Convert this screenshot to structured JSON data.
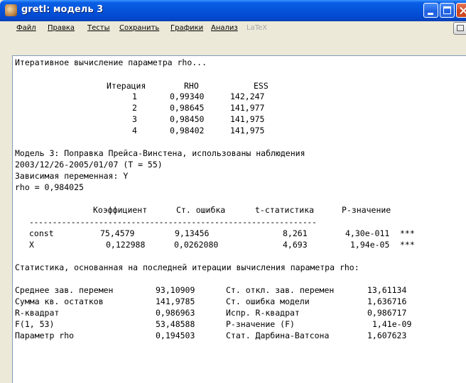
{
  "window": {
    "title": "gretl: модель 3"
  },
  "menu": {
    "file": "Файл",
    "edit": "Правка",
    "tests": "Тесты",
    "save": "Сохранить",
    "graphs": "Графики",
    "analysis": "Анализ",
    "latex": "LaTeX"
  },
  "output": {
    "iter_header": "Итеративное вычисление параметра rho...",
    "iter_table": {
      "headers": [
        "Итерация",
        "RHO",
        "ESS"
      ],
      "rows": [
        [
          "1",
          "0,99340",
          "142,247"
        ],
        [
          "2",
          "0,98645",
          "141,977"
        ],
        [
          "3",
          "0,98450",
          "141,975"
        ],
        [
          "4",
          "0,98402",
          "141,975"
        ]
      ]
    },
    "model_line": "Модель 3: Поправка Прейса-Винстена, использованы наблюдения",
    "range_line": "2003/12/26-2005/01/07 (T = 55)",
    "dep_var": "Зависимая переменная: Y",
    "rho_line": "rho = 0,984025",
    "coef_headers": [
      "Коэффициент",
      "Ст. ошибка",
      "t-статистика",
      "P-значение"
    ],
    "dashes": "--------------------------------------------------------------",
    "coef_rows": [
      {
        "name": "const",
        "coef": "75,4579",
        "se": "9,13456",
        "t": "8,261",
        "p": "4,30e-011",
        "stars": "***"
      },
      {
        "name": "X",
        "coef": "0,122988",
        "se": "0,0262080",
        "t": "4,693",
        "p": "1,94e-05",
        "stars": "***"
      }
    ],
    "stats_header": "Статистика, основанная на последней итерации вычисления параметра rho:",
    "stats": [
      {
        "l_label": "Среднее зав. перемен",
        "l_val": "93,10909",
        "r_label": "Ст. откл. зав. перемен",
        "r_val": "13,61134"
      },
      {
        "l_label": "Сумма кв. остатков",
        "l_val": "141,9785",
        "r_label": "Ст. ошибка модели",
        "r_val": "1,636716"
      },
      {
        "l_label": "R-квадрат",
        "l_val": "0,986963",
        "r_label": "Испр. R-квадрат",
        "r_val": "0,986717"
      },
      {
        "l_label": "F(1, 53)",
        "l_val": "53,48588",
        "r_label": "Р-значение (F)",
        "r_val": "1,41e-09"
      },
      {
        "l_label": "Параметр rho",
        "l_val": "0,194503",
        "r_label": "Стат. Дарбина-Ватсона",
        "r_val": "1,607623"
      }
    ]
  }
}
